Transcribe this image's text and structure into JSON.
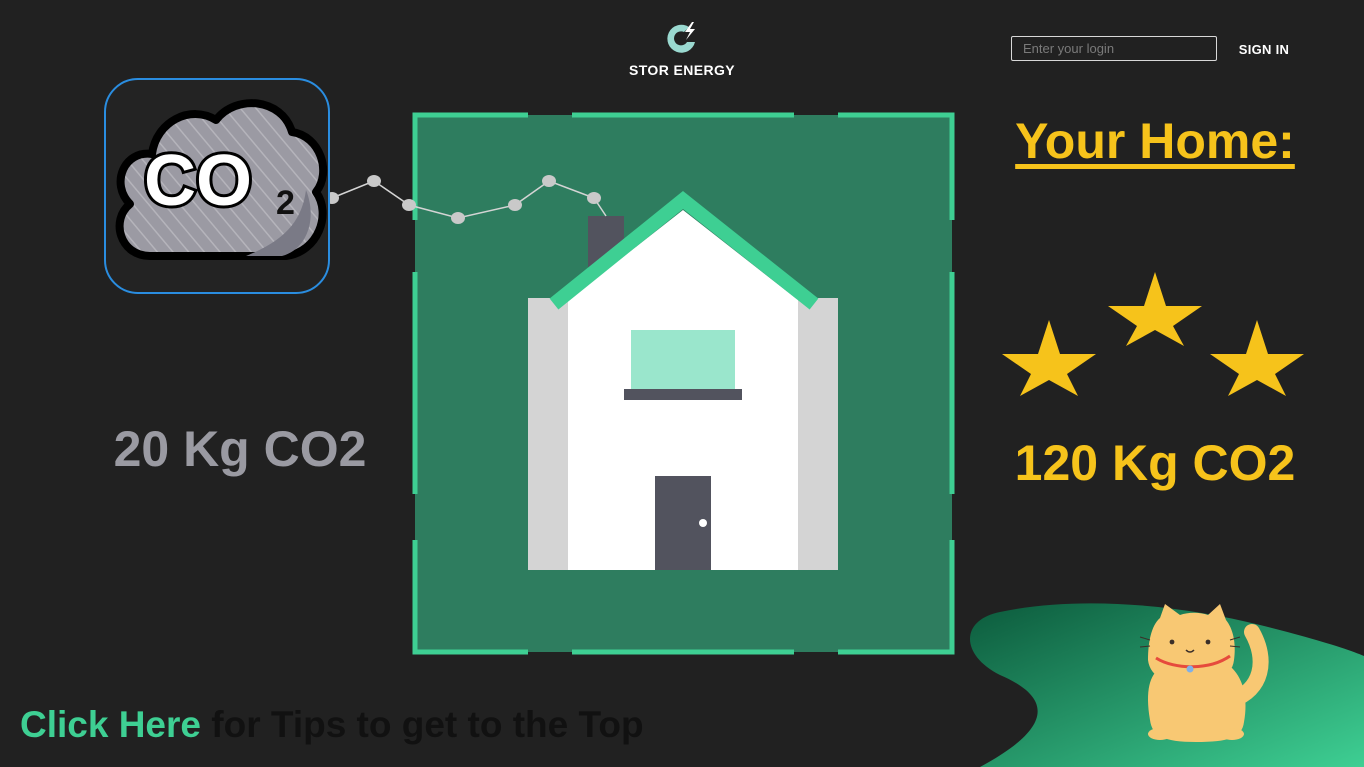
{
  "header": {
    "brand_name": "STOR ENERGY",
    "logo_icon": "lightning-c-icon",
    "login_placeholder": "Enter your login",
    "signin_label": "SIGN IN"
  },
  "co2_card": {
    "label_main": "CO",
    "label_sub": "2",
    "icon": "co2-cloud-icon"
  },
  "left_stat": "20 Kg CO2",
  "right_panel": {
    "title": "Your Home:",
    "stars": 3,
    "stat": "120 Kg CO2"
  },
  "cta": {
    "link_text": "Click Here",
    "rest_text": " for Tips to get to the Top"
  },
  "colors": {
    "background": "#212121",
    "frame_green": "#2e7d5f",
    "accent_green": "#3ecf93",
    "yellow": "#f6c31b",
    "gray_text": "#9a9aa2",
    "card_border": "#2a8de0"
  }
}
